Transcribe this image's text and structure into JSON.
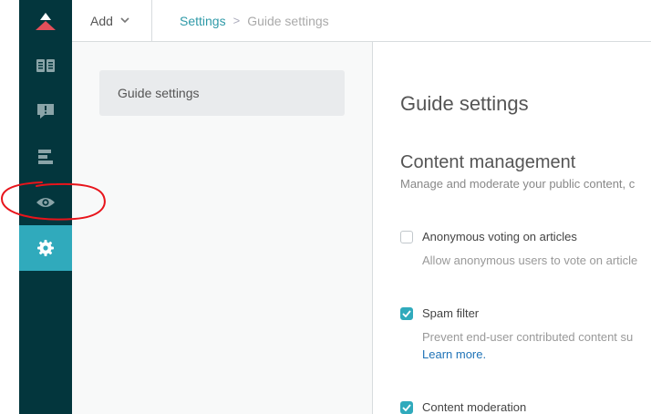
{
  "colors": {
    "rail_bg": "#03363d",
    "rail_active": "#30aabc",
    "logo_red": "#e34f5a",
    "checkbox_accent": "#30aabc",
    "annotation_red": "#e8141b"
  },
  "rail": {
    "logo_icon": "zendesk-guide-logo",
    "items": [
      {
        "icon": "book-icon",
        "active": false
      },
      {
        "icon": "alert-comment-icon",
        "active": false
      },
      {
        "icon": "arrange-content-icon",
        "active": false
      },
      {
        "icon": "eye-icon",
        "active": false
      },
      {
        "icon": "gear-icon",
        "active": true
      }
    ]
  },
  "topbar": {
    "add_label": "Add",
    "breadcrumb": {
      "parent": "Settings",
      "separator": ">",
      "current": "Guide settings"
    }
  },
  "subnav": {
    "items": [
      {
        "label": "Guide settings",
        "selected": true
      }
    ]
  },
  "main": {
    "title": "Guide settings",
    "section": {
      "title": "Content management",
      "description": "Manage and moderate your public content, c"
    },
    "options": [
      {
        "label": "Anonymous voting on articles",
        "checked": false,
        "description": "Allow anonymous users to vote on article"
      },
      {
        "label": "Spam filter",
        "checked": true,
        "description": "Prevent end-user contributed content su",
        "link": "Learn more."
      },
      {
        "label": "Content moderation",
        "checked": true
      }
    ]
  }
}
